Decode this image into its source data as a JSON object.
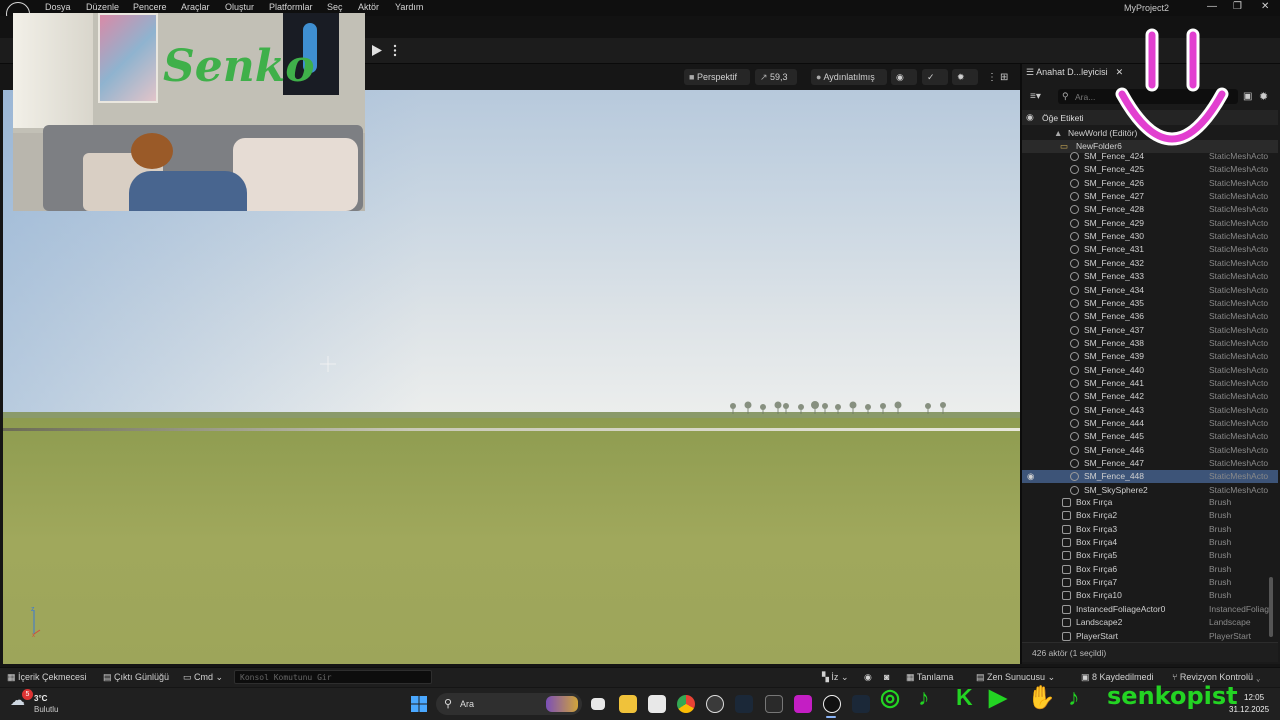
{
  "menubar": {
    "items": [
      "Dosya",
      "Düzenle",
      "Pencere",
      "Araçlar",
      "Oluştur",
      "Platformlar",
      "Seç",
      "Aktör",
      "Yardım"
    ],
    "project_title": "MyProject2",
    "minimize": "—",
    "restore": "❐",
    "close": "✕"
  },
  "viewport_toolbar": {
    "perspective": "Perspektif",
    "fov": "59,3",
    "lighting": "Aydınlatılmış"
  },
  "outliner": {
    "tab_title": "Anahat D...leyicisi",
    "search_placeholder": "Ara...",
    "column_label": "Öğe Etiketi",
    "world": "NewWorld (Editör)",
    "folder": "NewFolder6",
    "rows": [
      {
        "label": "SM_Fence_424",
        "type": "StaticMeshActo"
      },
      {
        "label": "SM_Fence_425",
        "type": "StaticMeshActo"
      },
      {
        "label": "SM_Fence_426",
        "type": "StaticMeshActo"
      },
      {
        "label": "SM_Fence_427",
        "type": "StaticMeshActo"
      },
      {
        "label": "SM_Fence_428",
        "type": "StaticMeshActo"
      },
      {
        "label": "SM_Fence_429",
        "type": "StaticMeshActo"
      },
      {
        "label": "SM_Fence_430",
        "type": "StaticMeshActo"
      },
      {
        "label": "SM_Fence_431",
        "type": "StaticMeshActo"
      },
      {
        "label": "SM_Fence_432",
        "type": "StaticMeshActo"
      },
      {
        "label": "SM_Fence_433",
        "type": "StaticMeshActo"
      },
      {
        "label": "SM_Fence_434",
        "type": "StaticMeshActo"
      },
      {
        "label": "SM_Fence_435",
        "type": "StaticMeshActo"
      },
      {
        "label": "SM_Fence_436",
        "type": "StaticMeshActo"
      },
      {
        "label": "SM_Fence_437",
        "type": "StaticMeshActo"
      },
      {
        "label": "SM_Fence_438",
        "type": "StaticMeshActo"
      },
      {
        "label": "SM_Fence_439",
        "type": "StaticMeshActo"
      },
      {
        "label": "SM_Fence_440",
        "type": "StaticMeshActo"
      },
      {
        "label": "SM_Fence_441",
        "type": "StaticMeshActo"
      },
      {
        "label": "SM_Fence_442",
        "type": "StaticMeshActo"
      },
      {
        "label": "SM_Fence_443",
        "type": "StaticMeshActo"
      },
      {
        "label": "SM_Fence_444",
        "type": "StaticMeshActo"
      },
      {
        "label": "SM_Fence_445",
        "type": "StaticMeshActo"
      },
      {
        "label": "SM_Fence_446",
        "type": "StaticMeshActo"
      },
      {
        "label": "SM_Fence_447",
        "type": "StaticMeshActo"
      },
      {
        "label": "SM_Fence_448",
        "type": "StaticMeshActo",
        "selected": true
      },
      {
        "label": "SM_SkySphere2",
        "type": "StaticMeshActo"
      }
    ],
    "root_rows": [
      {
        "label": "Box Fırça",
        "type": "Brush"
      },
      {
        "label": "Box Fırça2",
        "type": "Brush"
      },
      {
        "label": "Box Fırça3",
        "type": "Brush"
      },
      {
        "label": "Box Fırça4",
        "type": "Brush"
      },
      {
        "label": "Box Fırça5",
        "type": "Brush"
      },
      {
        "label": "Box Fırça6",
        "type": "Brush"
      },
      {
        "label": "Box Fırça7",
        "type": "Brush"
      },
      {
        "label": "Box Fırça10",
        "type": "Brush"
      },
      {
        "label": "InstancedFoliageActor0",
        "type": "InstancedFoliag"
      },
      {
        "label": "Landscape2",
        "type": "Landscape"
      },
      {
        "label": "PlayerStart",
        "type": "PlayerStart"
      }
    ],
    "footer": "426 aktör (1 seçildi)"
  },
  "statusbar": {
    "content_drawer": "İçerik Çekmecesi",
    "output_log": "Çıktı Günlüğü",
    "cmd": "Cmd",
    "console_placeholder": "Konsol Komutunu Gir",
    "trace": "İz",
    "derive": "Tanılama",
    "zen": "Zen Sunucusu",
    "unsaved": "8 Kaydedilmedi",
    "revision": "Revizyon Kontrolü"
  },
  "taskbar": {
    "weather_temp": "3°C",
    "weather_desc": "Bulutlu",
    "weather_badge": "5",
    "search": "Ara",
    "time": "12:05",
    "date": "31.12.2025"
  },
  "overlay": {
    "brand": "senkopist",
    "wall_text": "Senko"
  },
  "colors": {
    "selection": "#3d5478",
    "accent_pink": "#e23fd0",
    "social_green": "#23d423"
  }
}
